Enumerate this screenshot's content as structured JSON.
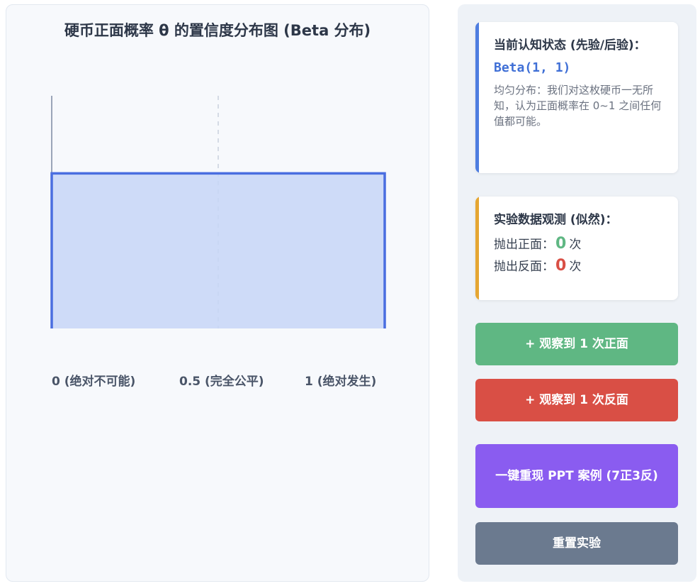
{
  "chart": {
    "title": "硬币正面概率 θ 的置信度分布图 (Beta 分布)",
    "tick_labels": [
      "0 (绝对不可能)",
      "0.5 (完全公平)",
      "1 (绝对发生)"
    ]
  },
  "chart_data": {
    "type": "area",
    "title": "硬币正面概率 θ 的置信度分布图 (Beta 分布)",
    "distribution": "Beta(1, 1)",
    "x": [
      0,
      1
    ],
    "y": [
      1,
      1
    ],
    "xlim": [
      0,
      1
    ],
    "ylim": [
      0,
      1.5
    ],
    "x_tick_labels": [
      "0 (绝对不可能)",
      "0.5 (完全公平)",
      "1 (绝对发生)"
    ],
    "reference_line_x": 0.5,
    "grid": false,
    "fill_color": "#c7d6f7",
    "line_color": "#4a6ee0"
  },
  "prior_card": {
    "heading": "当前认知状态 (先验/后验)：",
    "formula": "Beta(1, 1)",
    "description": "均匀分布：我们对这枚硬币一无所知，认为正面概率在 0~1 之间任何值都可能。"
  },
  "data_card": {
    "heading": "实验数据观测 (似然)：",
    "heads_label": "抛出正面：",
    "heads_count": "0",
    "tails_label": "抛出反面：",
    "tails_count": "0",
    "unit": "次"
  },
  "buttons": {
    "add_heads": "+ 观察到 1 次正面",
    "add_tails": "+ 观察到 1 次反面",
    "load_case": "一键重现 PPT 案例 (7正3反)",
    "reset": "重置实验"
  },
  "colors": {
    "heads": "#5fb783",
    "tails": "#d94f45",
    "case": "#8a5cf0",
    "reset": "#6b7a8f",
    "accent_blue": "#4e7de0",
    "accent_amber": "#e5a632"
  }
}
